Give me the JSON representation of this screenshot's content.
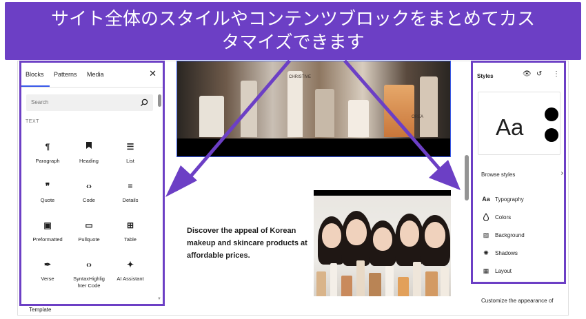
{
  "banner": {
    "line1": "サイト全体のスタイルやコンテンツブロックをまとめてカス",
    "line2": "タマイズできます"
  },
  "inserter": {
    "tabs": [
      "Blocks",
      "Patterns",
      "Media"
    ],
    "close_icon": "close-icon",
    "search_placeholder": "Search",
    "section_label": "TEXT",
    "blocks": [
      {
        "label": "Paragraph",
        "icon": "¶"
      },
      {
        "label": "Heading",
        "icon": "🔖"
      },
      {
        "label": "List",
        "icon": "☰"
      },
      {
        "label": "Quote",
        "icon": "❞"
      },
      {
        "label": "Code",
        "icon": "‹›"
      },
      {
        "label": "Details",
        "icon": "≡"
      },
      {
        "label": "Preformatted",
        "icon": "▣"
      },
      {
        "label": "Pullquote",
        "icon": "▭"
      },
      {
        "label": "Table",
        "icon": "⊞"
      },
      {
        "label": "Verse",
        "icon": "✒"
      },
      {
        "label": "SyntaxHighlighter Code",
        "icon": "‹›"
      },
      {
        "label": "AI Assistant",
        "icon": "✦"
      }
    ]
  },
  "footer": {
    "template_label": "Template"
  },
  "canvas": {
    "promo_text": "Discover the appeal of Korean makeup and skincare products at affordable prices.",
    "hero_labels": [
      "CHRISTIVE",
      "OREA"
    ]
  },
  "styles_panel": {
    "title": "Styles",
    "preview_text": "Aa",
    "browse_label": "Browse styles",
    "menu": [
      {
        "label": "Typography",
        "icon": "Aa"
      },
      {
        "label": "Colors",
        "icon": "◯"
      },
      {
        "label": "Background",
        "icon": "▨"
      },
      {
        "label": "Shadows",
        "icon": "✺"
      },
      {
        "label": "Layout",
        "icon": "▦"
      }
    ],
    "customize_text": "Customize the appearance of"
  },
  "colors": {
    "accent_purple": "#6c3fc5",
    "wp_blue": "#3858e9"
  }
}
